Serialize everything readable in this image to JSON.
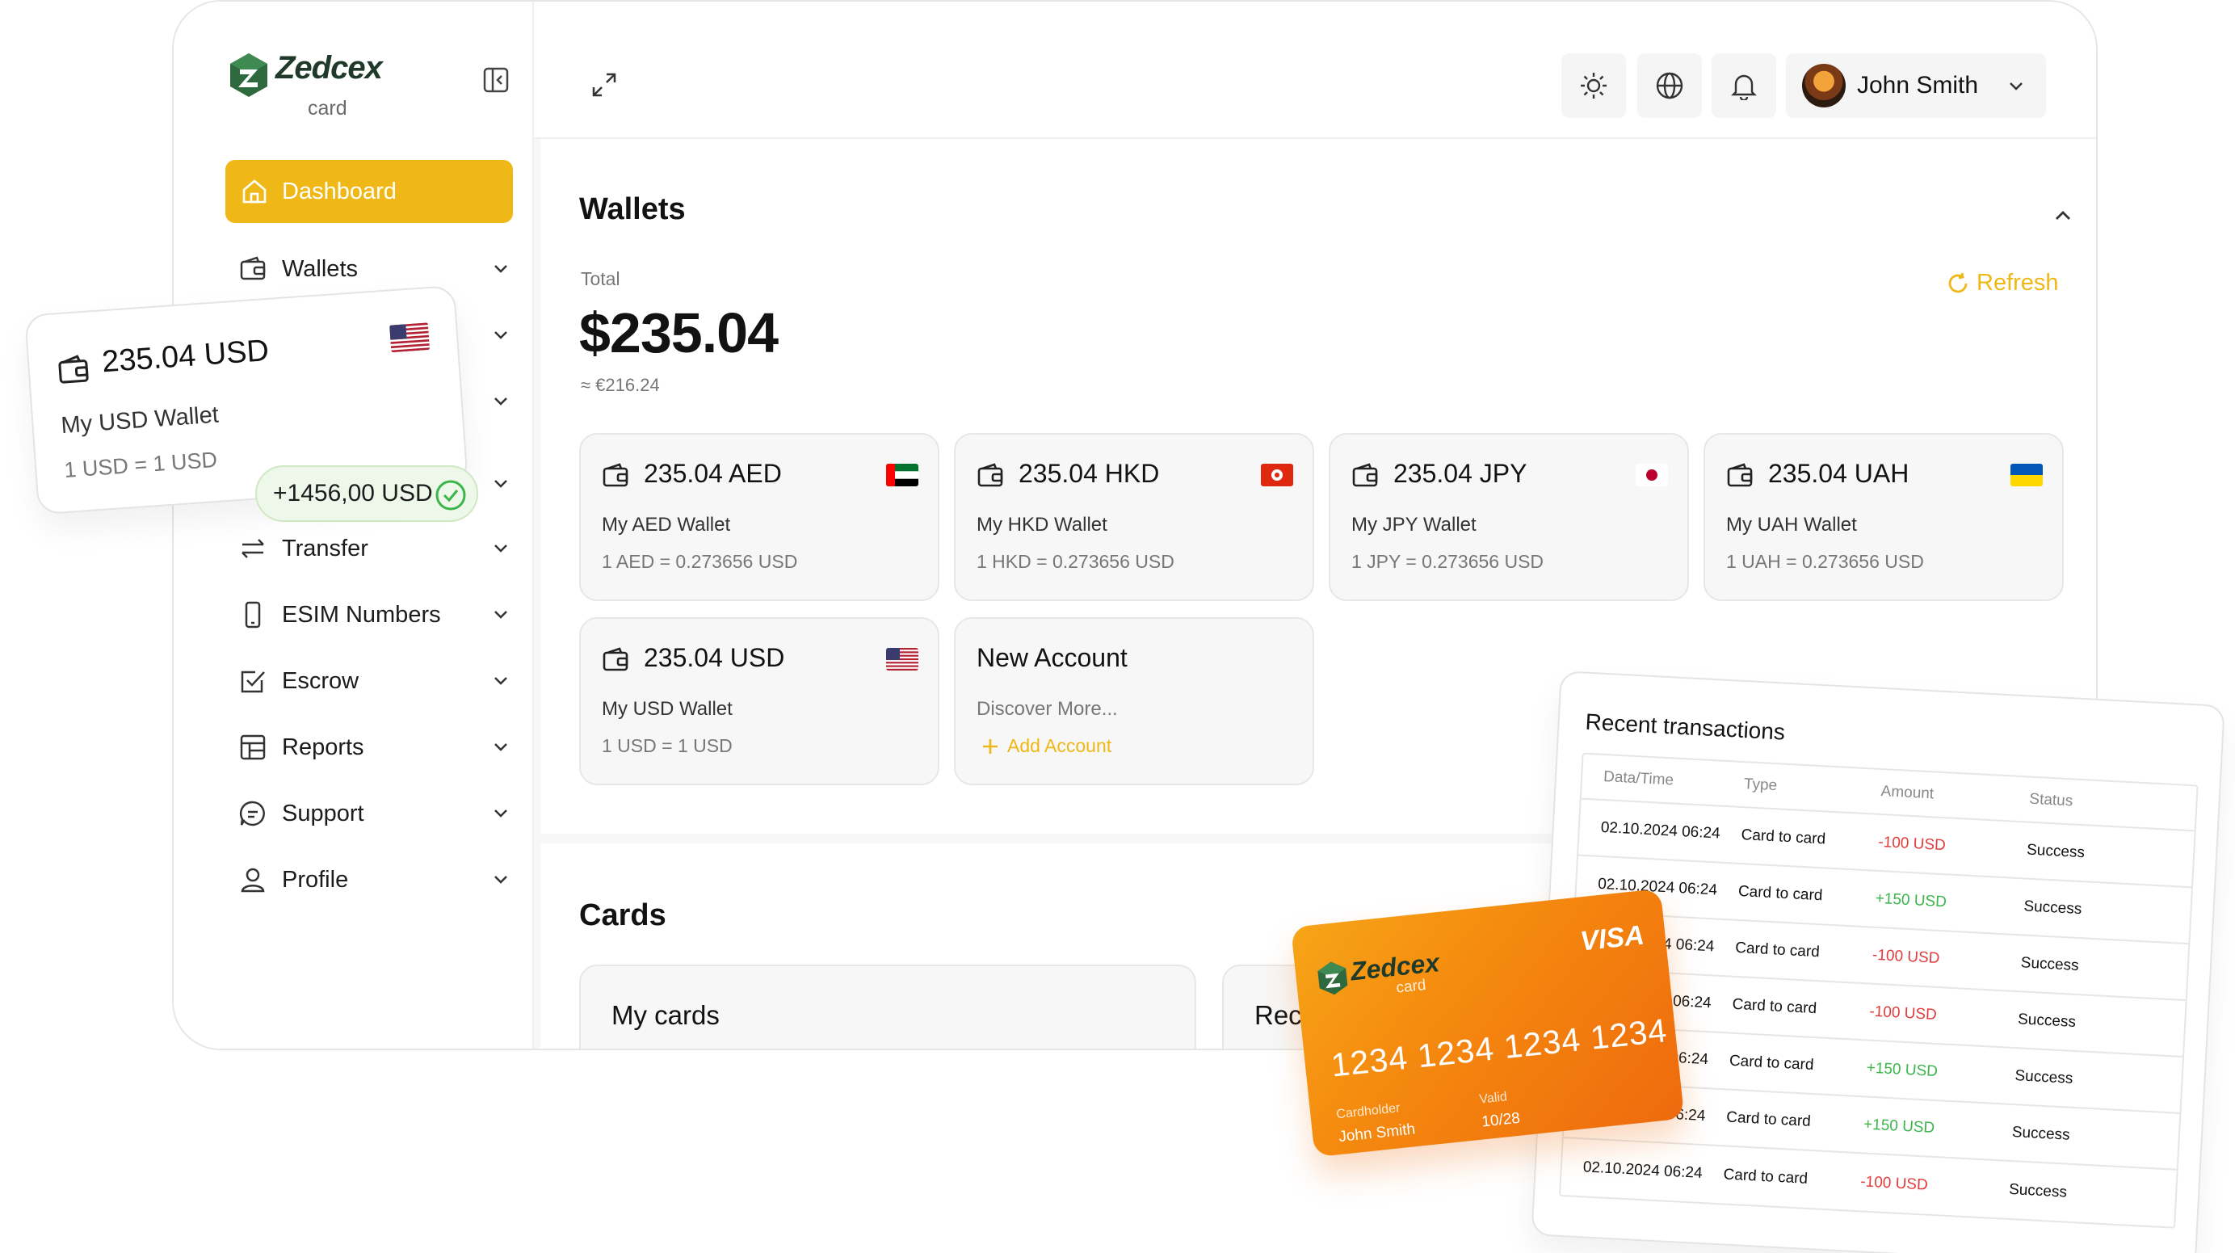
{
  "brand": {
    "name": "Zedcex",
    "sub": "card"
  },
  "sidebar": {
    "dashboard_label": "Dashboard",
    "items": [
      {
        "label": "Wallets",
        "icon": "wallet-icon"
      },
      {
        "label": "Transfer",
        "icon": "transfer-icon"
      },
      {
        "label": "ESIM Numbers",
        "icon": "phone-icon"
      },
      {
        "label": "Escrow",
        "icon": "checkbox-icon"
      },
      {
        "label": "Reports",
        "icon": "table-icon"
      },
      {
        "label": "Support",
        "icon": "chat-icon"
      },
      {
        "label": "Profile",
        "icon": "user-icon"
      }
    ]
  },
  "topbar": {
    "user_name": "John Smith"
  },
  "wallets": {
    "title": "Wallets",
    "total_label": "Total",
    "total_value": "$235.04",
    "total_eur": "≈ €216.24",
    "refresh_label": "Refresh",
    "cards": [
      {
        "amount": "235.04 AED",
        "name": "My AED Wallet",
        "rate": "1 AED = 0.273656 USD",
        "flag": "uae"
      },
      {
        "amount": "235.04 HKD",
        "name": "My HKD Wallet",
        "rate": "1 HKD = 0.273656 USD",
        "flag": "hk"
      },
      {
        "amount": "235.04 JPY",
        "name": "My JPY Wallet",
        "rate": "1 JPY = 0.273656 USD",
        "flag": "jp"
      },
      {
        "amount": "235.04 UAH",
        "name": "My UAH Wallet",
        "rate": "1 UAH = 0.273656 USD",
        "flag": "ua"
      },
      {
        "amount": "235.04 USD",
        "name": "My USD Wallet",
        "rate": "1 USD = 1 USD",
        "flag": "us"
      }
    ],
    "new_account": {
      "title": "New Account",
      "subtitle": "Discover More...",
      "add_label": "Add Account"
    }
  },
  "cards_section": {
    "title": "Cards",
    "my_cards_label": "My cards",
    "second_label": "Rec"
  },
  "float_wallet": {
    "amount": "235.04 USD",
    "name": "My USD Wallet",
    "rate": "1 USD = 1 USD"
  },
  "toast": {
    "text": "+1456,00 USD"
  },
  "transactions": {
    "title": "Recent transactions",
    "headers": [
      "Data/Time",
      "Type",
      "Amount",
      "Status"
    ],
    "rows": [
      {
        "date": "02.10.2024 06:24",
        "type": "Card to card",
        "amount": "-100 USD",
        "status": "Success",
        "sign": "neg"
      },
      {
        "date": "02.10.2024 06:24",
        "type": "Card to card",
        "amount": "+150 USD",
        "status": "Success",
        "sign": "pos"
      },
      {
        "date": "02.10.2024 06:24",
        "type": "Card to card",
        "amount": "-100 USD",
        "status": "Success",
        "sign": "neg"
      },
      {
        "date": "02.10.2024 06:24",
        "type": "Card to card",
        "amount": "-100 USD",
        "status": "Success",
        "sign": "neg"
      },
      {
        "date": "02.10.2024 06:24",
        "type": "Card to card",
        "amount": "+150 USD",
        "status": "Success",
        "sign": "pos"
      },
      {
        "date": "02.10.2024 06:24",
        "type": "Card to card",
        "amount": "+150 USD",
        "status": "Success",
        "sign": "pos"
      },
      {
        "date": "02.10.2024 06:24",
        "type": "Card to card",
        "amount": "-100 USD",
        "status": "Success",
        "sign": "neg"
      }
    ]
  },
  "visa_card": {
    "brand_name": "Zedcex",
    "brand_sub": "card",
    "network": "VISA",
    "number": "1234 1234 1234 1234",
    "holder_label": "Cardholder",
    "holder": "John Smith",
    "valid_label": "Valid",
    "valid": "10/28"
  },
  "colors": {
    "accent": "#efb816",
    "negative": "#e23b3b",
    "positive": "#3bb54a",
    "logo_dark": "#1f3a2a"
  }
}
